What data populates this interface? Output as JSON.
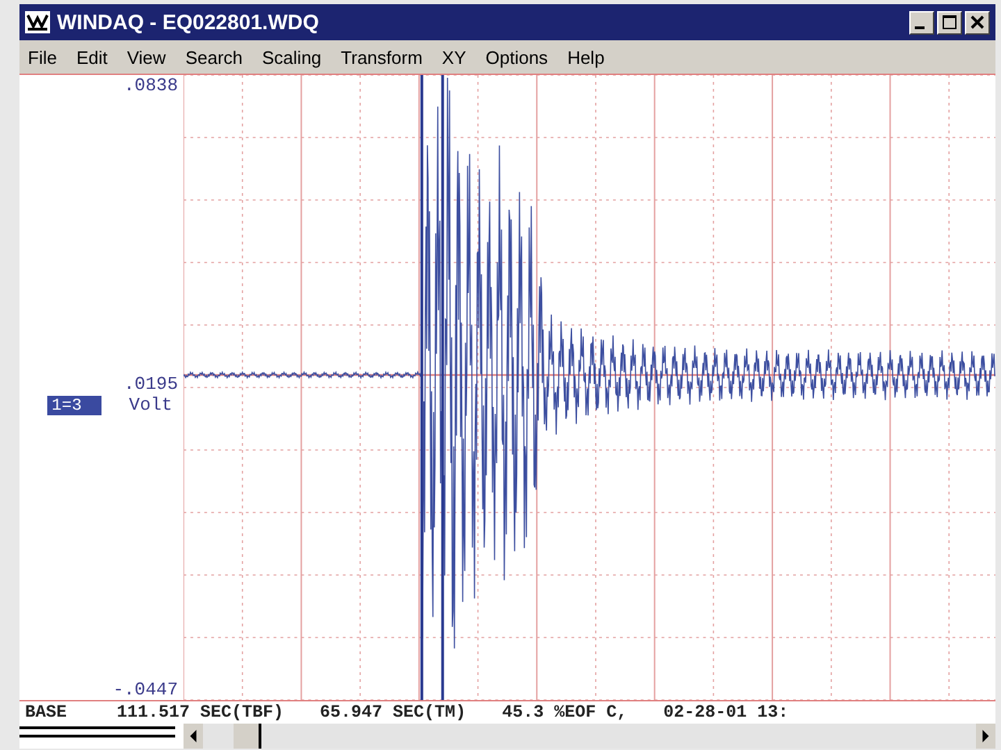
{
  "window": {
    "title": "WINDAQ - EQ022801.WDQ"
  },
  "menu": [
    "File",
    "Edit",
    "View",
    "Search",
    "Scaling",
    "Transform",
    "XY",
    "Options",
    "Help"
  ],
  "axis": {
    "top": ".0838",
    "middle": ".0195",
    "bottom": "-.0447",
    "unit": "Volt"
  },
  "channel": {
    "label": "1=3",
    "selected": true
  },
  "status_bar": [
    "BASE",
    "111.517 SEC(TBF)",
    "65.947 SEC(TM)",
    "45.3 %EOF C,",
    "02-28-01 13:"
  ]
}
